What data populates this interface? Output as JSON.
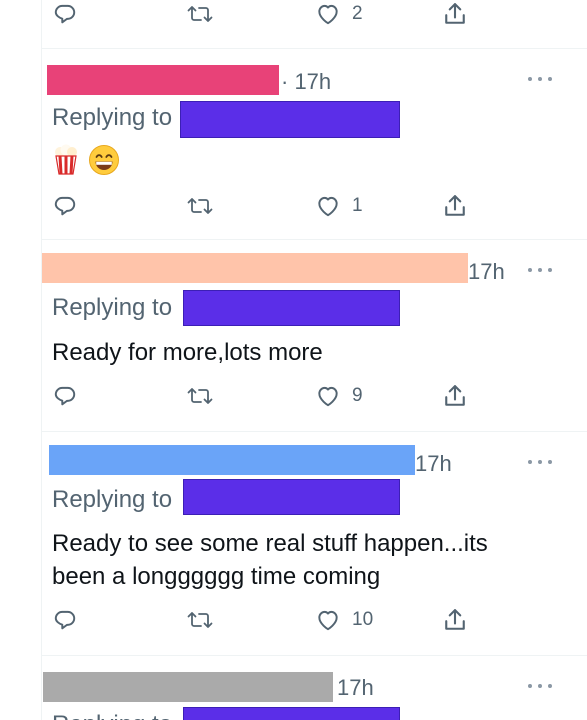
{
  "colors": {
    "text_primary": "#0f1419",
    "text_secondary": "#536471",
    "divider": "#eff3f4",
    "mention_redaction": "#5b2ee8",
    "icon_gray": "#536471"
  },
  "reply_prefix": "Replying to",
  "top_actions": {
    "reply_icon": "reply-icon",
    "retweet_icon": "retweet-icon",
    "like_icon": "heart-icon",
    "like_count": "2",
    "share_icon": "share-icon"
  },
  "tweets": [
    {
      "name_redaction_color": "#e84278",
      "time": "· 17h",
      "more_icon": "more-options-icon",
      "emojis": [
        "popcorn-emoji",
        "grinning-face-emoji"
      ],
      "text": "",
      "like_count": "1"
    },
    {
      "name_redaction_color": "#ffc4aa",
      "time": "17h",
      "more_icon": "more-options-icon",
      "text": "Ready for more,lots more",
      "like_count": "9"
    },
    {
      "name_redaction_color": "#6aa4f8",
      "time": "17h",
      "more_icon": "more-options-icon",
      "text": "Ready to see some real stuff happen...its been a longggggg time coming",
      "like_count": "10"
    },
    {
      "name_redaction_color": "#aaaaaa",
      "time": "17h",
      "more_icon": "more-options-icon",
      "text": ""
    }
  ]
}
